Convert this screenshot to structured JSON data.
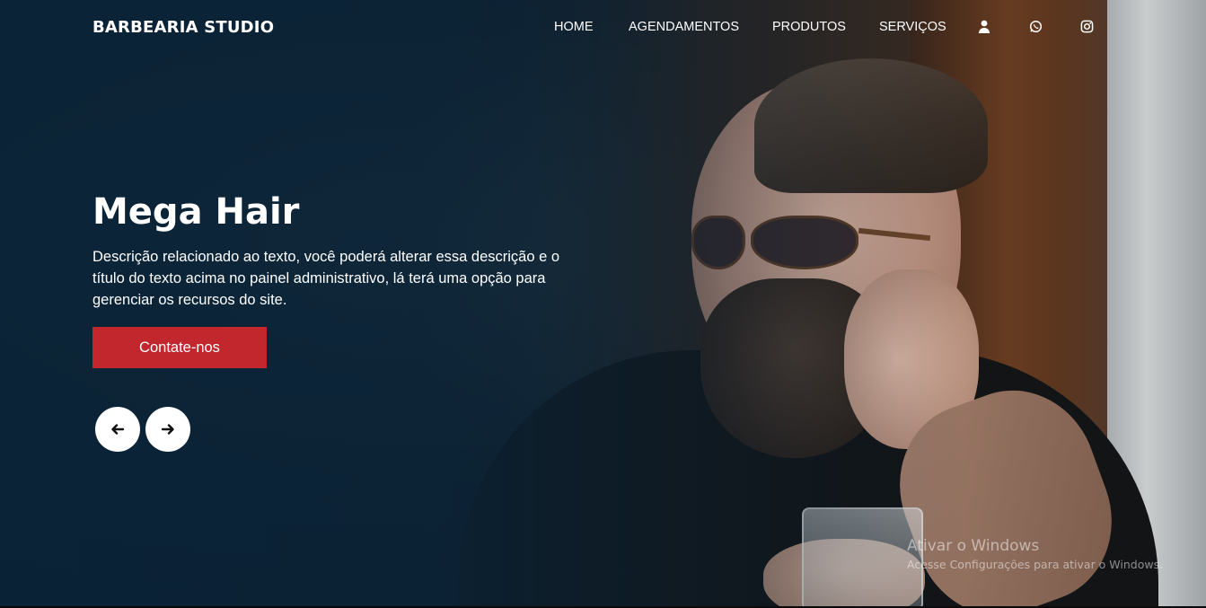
{
  "nav": {
    "brand": "BARBEARIA STUDIO",
    "items": [
      {
        "label": "HOME"
      },
      {
        "label": "AGENDAMENTOS"
      },
      {
        "label": "PRODUTOS"
      },
      {
        "label": "SERVIÇOS"
      }
    ],
    "icons": [
      "user-icon",
      "whatsapp-icon",
      "instagram-icon"
    ]
  },
  "hero": {
    "title": "Mega Hair",
    "description": "Descrição relacionado ao texto, você poderá alterar essa descrição e o título do texto acima no painel administrativo, lá terá uma opção para gerenciar os recursos do site.",
    "cta_label": "Contate-nos",
    "accent_color": "#c1272d"
  },
  "carousel": {
    "prev_icon": "arrow-left-icon",
    "next_icon": "arrow-right-icon"
  },
  "watermark": {
    "title": "Ativar o Windows",
    "subtitle": "Acesse Configurações para ativar o Windows."
  }
}
